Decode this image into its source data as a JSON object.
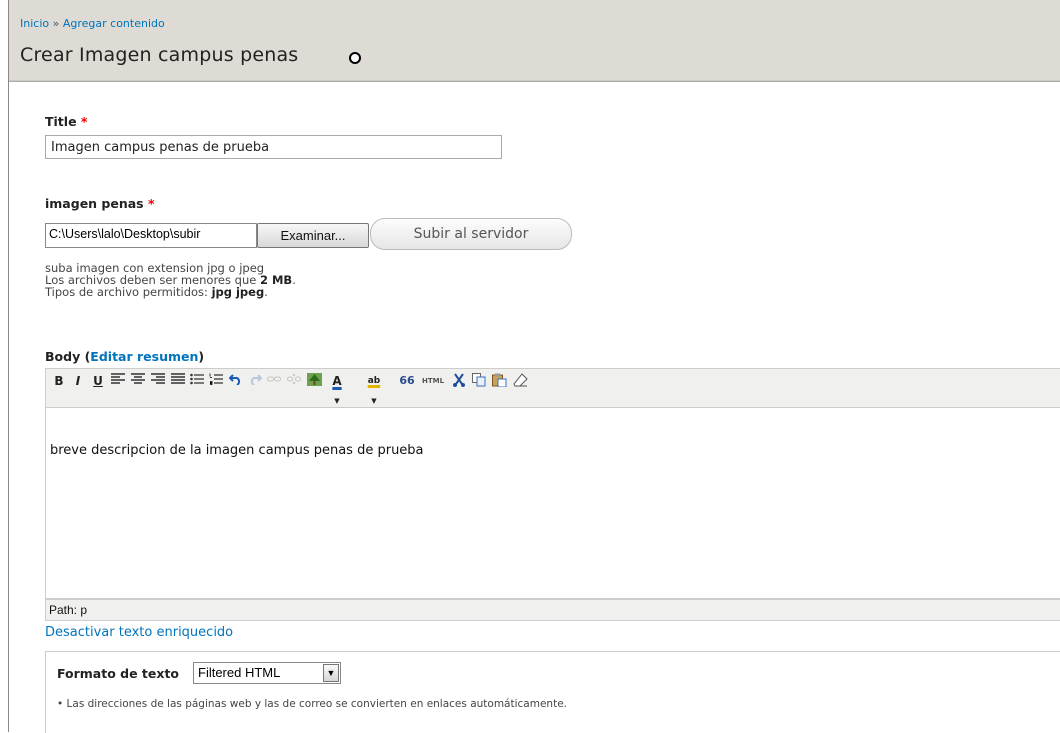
{
  "breadcrumb": {
    "home": "Inicio",
    "separator": "»",
    "current": "Agregar contenido"
  },
  "page_title": "Crear Imagen campus penas",
  "form": {
    "title": {
      "label": "Title",
      "required_mark": "*",
      "value": "Imagen campus penas de prueba"
    },
    "image": {
      "label": "imagen penas",
      "required_mark": "*",
      "file_path": "C:\\Users\\lalo\\Desktop\\subir",
      "browse_label": "Examinar...",
      "upload_label": "Subir al servidor",
      "help_1": "suba imagen con extension jpg o jpeg",
      "help_2_prefix": "Los archivos deben ser menores que",
      "help_2_size": "2 MB",
      "help_2_suffix": ".",
      "help_3_prefix": "Tipos de archivo permitidos:",
      "help_3_types": "jpg jpeg",
      "help_3_suffix": "."
    },
    "body": {
      "label": "Body",
      "paren_open": "(",
      "edit_summary": "Editar resumen",
      "paren_close": ")",
      "toolbar": {
        "bold": "B",
        "italic": "I",
        "underline": "U",
        "font_color": "A",
        "highlight": "ab",
        "blockquote": "66",
        "html": "HTML"
      },
      "content": "breve descripcion de la imagen campus penas de prueba",
      "path_label": "Path:",
      "path_value": "p",
      "disable_rich_text": "Desactivar texto enriquecido"
    },
    "text_format": {
      "label": "Formato de texto",
      "selected": "Filtered HTML",
      "tip": "Las direcciones de las páginas web y las de correo se convierten en enlaces automáticamente."
    }
  }
}
